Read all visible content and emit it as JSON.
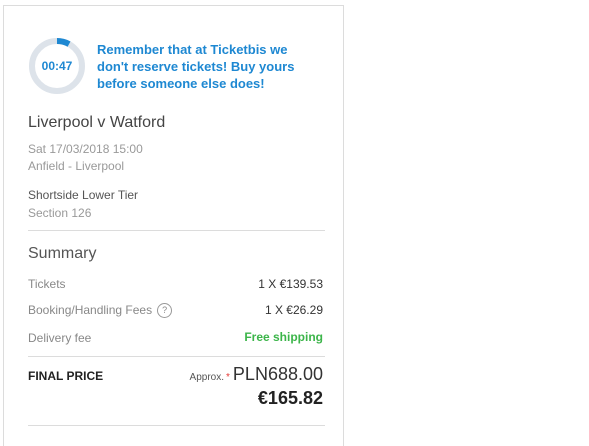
{
  "timer": {
    "display": "00:47",
    "progress_fraction": 0.08,
    "accent": "#1e88d2",
    "track": "#dde3ea"
  },
  "reminder": "Remember that at Ticketbis we don't reserve tickets! Buy yours before someone else does!",
  "event": {
    "title": "Liverpool v Watford",
    "datetime": "Sat 17/03/2018 15:00",
    "venue": "Anfield - Liverpool",
    "seat_area": "Shortside Lower Tier",
    "section": "Section 126"
  },
  "summary": {
    "title": "Summary",
    "rows": [
      {
        "label": "Tickets",
        "value": "1 X €139.53"
      },
      {
        "label": "Booking/Handling Fees",
        "help_icon": "?",
        "value": "1 X €26.29"
      },
      {
        "label": "Delivery fee",
        "value": "Free shipping"
      }
    ],
    "final_label": "FINAL PRICE",
    "approx_label": "Approx.",
    "asterisk": "*",
    "approx_price": "PLN688.00",
    "final_price": "€165.82"
  },
  "colors": {
    "free_shipping": "#3cb54a",
    "asterisk": "#e53935"
  }
}
